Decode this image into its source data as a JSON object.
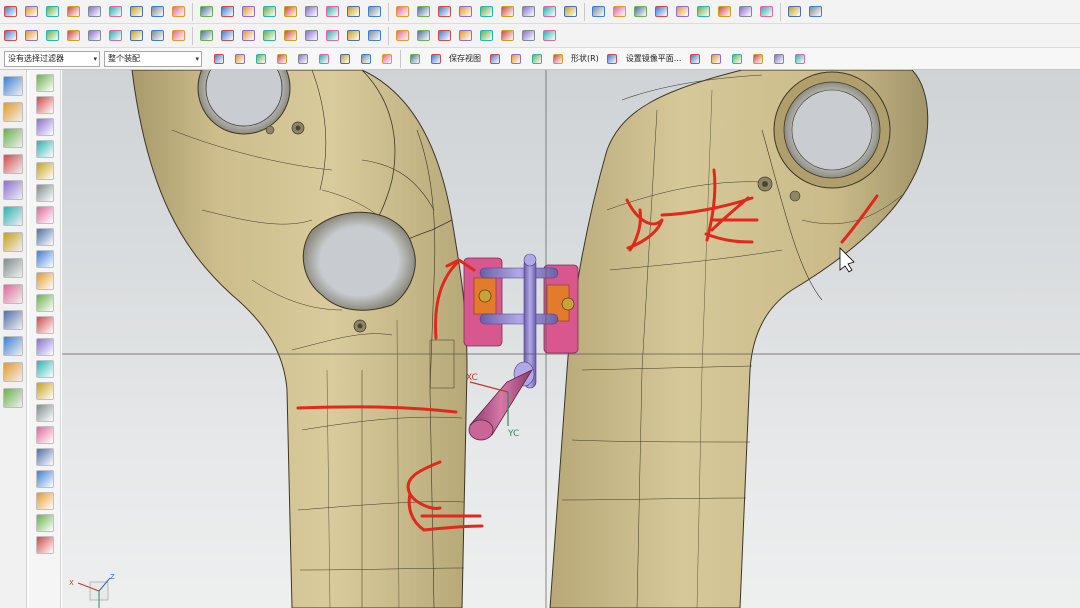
{
  "selection_bar": {
    "filter_combo": "没有选择过滤器",
    "scope_combo": "整个装配",
    "save_view_label": "保存视图",
    "shape_label": "形状(R)",
    "mirror_plane_label": "设置镜像平面..."
  },
  "viewport": {
    "wcs_x_label": "XC",
    "wcs_y_label": "YC",
    "triad_x_label": "X",
    "triad_z_label": "Z"
  },
  "colors": {
    "part_face": "#cdbd8c",
    "part_edge": "#3c3628",
    "annotation_red": "#e0291b",
    "fixture_pink": "#d9578f",
    "fixture_orange": "#e47a2c",
    "fixture_purple": "#8278c4",
    "wcs_xc": "#c0392b",
    "wcs_yc": "#2e8b57"
  },
  "icons": {
    "toolbar_row1": [
      "sketch-icon",
      "extrude-icon",
      "revolve-icon",
      "cylinder-icon",
      "block-icon",
      "cone-icon",
      "sphere-icon",
      "hole-icon",
      "boss-icon",
      "pocket-icon",
      "pad-icon",
      "slot-icon",
      "groove-icon",
      "datum-plane-icon",
      "chamfer-icon",
      "edge-blend-icon",
      "shell-icon",
      "thread-icon",
      "pattern-icon",
      "mirror-icon",
      "unite-icon",
      "subtract-icon",
      "intersect-icon",
      "trim-body-icon",
      "split-body-icon",
      "offset-face-icon",
      "draft-icon",
      "sew-icon",
      "patch-icon",
      "replace-face-icon",
      "move-face-icon",
      "measure-icon",
      "analysis-icon",
      "curve-icon",
      "spline-icon",
      "line-icon",
      "arc-icon",
      "point-icon"
    ],
    "toolbar_row2": [
      "surface-icon",
      "through-curves-icon",
      "swept-icon",
      "n-sided-icon",
      "bounded-plane-icon",
      "extension-icon",
      "law-extension-icon",
      "offset-surface-icon",
      "trim-sheet-icon",
      "assembly-icon",
      "add-component-icon",
      "constraint-icon",
      "move-component-icon",
      "explode-icon",
      "layer-icon",
      "view-icon",
      "render-icon",
      "display-icon",
      "line-icon",
      "arc-icon",
      "rectangle-icon",
      "polygon-icon",
      "fillet-icon",
      "curve-offset-icon",
      "project-icon",
      "intersection-curve-icon"
    ],
    "left_bar": [
      "roles-icon",
      "assembly-navigator-icon",
      "constraint-navigator-icon",
      "part-navigator-icon",
      "reuse-library-icon",
      "web-browser-icon",
      "history-icon",
      "system-materials-icon",
      "process-studio-icon",
      "manufacturing-wizard-icon",
      "roles-list-icon",
      "system-scenes-icon",
      "palette-icon"
    ]
  }
}
